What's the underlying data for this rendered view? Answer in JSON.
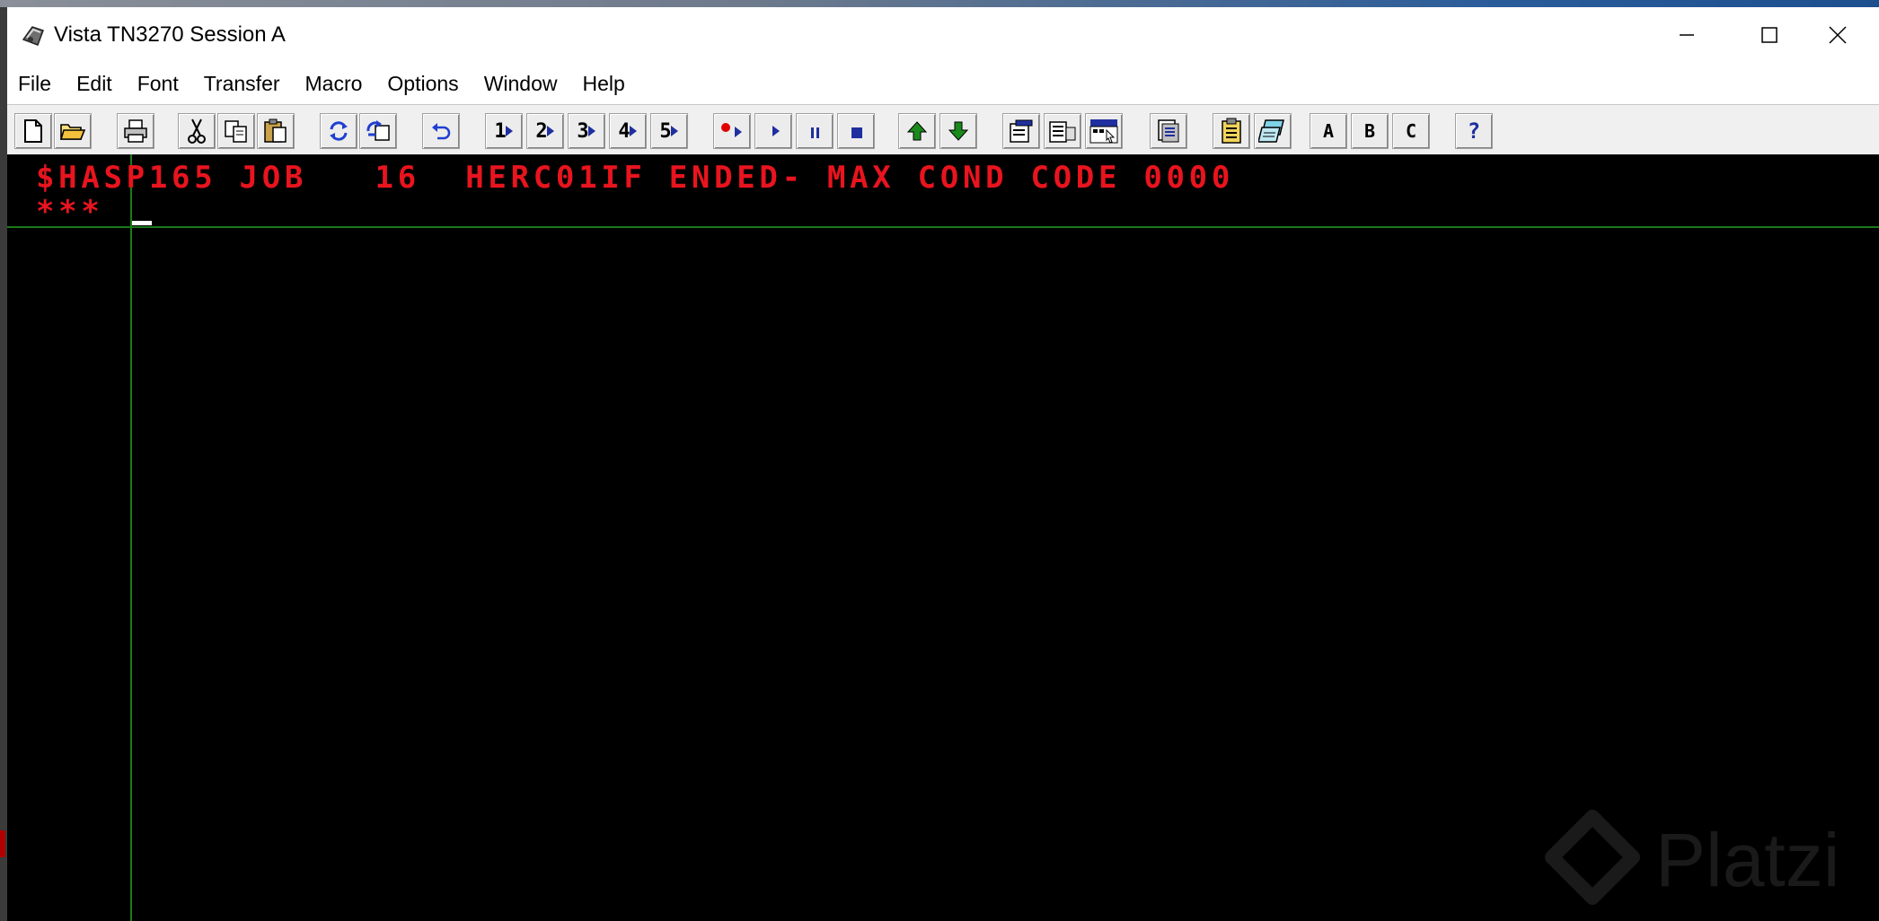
{
  "window": {
    "title": "Vista TN3270 Session A",
    "icon": "terminal-app-icon",
    "controls": [
      "minimize-icon",
      "maximize-icon",
      "close-icon"
    ]
  },
  "menu": [
    "File",
    "Edit",
    "Font",
    "Transfer",
    "Macro",
    "Options",
    "Window",
    "Help"
  ],
  "toolbar": {
    "buttons": [
      {
        "name": "new-icon"
      },
      {
        "name": "open-folder-icon"
      },
      {
        "name": "print-icon"
      },
      {
        "name": "cut-icon"
      },
      {
        "name": "copy-icon"
      },
      {
        "name": "paste-icon"
      },
      {
        "name": "refresh-icon"
      },
      {
        "name": "reconnect-icon"
      },
      {
        "name": "undo-icon"
      },
      {
        "name": "macro-1-icon",
        "label": "1"
      },
      {
        "name": "macro-2-icon",
        "label": "2"
      },
      {
        "name": "macro-3-icon",
        "label": "3"
      },
      {
        "name": "macro-4-icon",
        "label": "4"
      },
      {
        "name": "macro-5-icon",
        "label": "5"
      },
      {
        "name": "record-icon"
      },
      {
        "name": "play-icon"
      },
      {
        "name": "pause-icon"
      },
      {
        "name": "stop-icon"
      },
      {
        "name": "arrow-up-icon"
      },
      {
        "name": "arrow-down-icon"
      },
      {
        "name": "properties-icon"
      },
      {
        "name": "document-list-icon"
      },
      {
        "name": "keyboard-map-icon"
      },
      {
        "name": "screen-capture-icon"
      },
      {
        "name": "clipboard-icon"
      },
      {
        "name": "notes-icon"
      },
      {
        "name": "session-a-icon",
        "label": "A"
      },
      {
        "name": "session-b-icon",
        "label": "B"
      },
      {
        "name": "session-c-icon",
        "label": "C"
      },
      {
        "name": "help-icon",
        "label": "?"
      }
    ]
  },
  "terminal": {
    "line1": "$HASP165 JOB   16  HERC01IF ENDED- MAX COND CODE 0000",
    "line2": "***",
    "text_color": "#e8141e",
    "background": "#000000",
    "crosshair_color": "#1a7a1a"
  },
  "watermark": {
    "text": "Platzi"
  }
}
